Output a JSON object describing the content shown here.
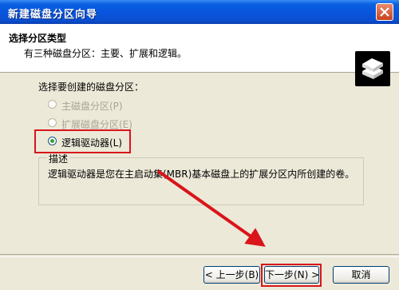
{
  "window": {
    "title": "新建磁盘分区向导"
  },
  "header": {
    "title": "选择分区类型",
    "subtitle": "有三种磁盘分区：主要、扩展和逻辑。",
    "icon": "disk-stack-icon"
  },
  "partition": {
    "section_label": "选择要创建的磁盘分区：",
    "options": [
      {
        "label": "主磁盘分区(P)",
        "enabled": false,
        "selected": false
      },
      {
        "label": "扩展磁盘分区(E)",
        "enabled": false,
        "selected": false
      },
      {
        "label": "逻辑驱动器(L)",
        "enabled": true,
        "selected": true
      }
    ]
  },
  "description": {
    "legend": "描述",
    "text": "逻辑驱动器是您在主启动集(MBR)基本磁盘上的扩展分区内所创建的卷。"
  },
  "buttons": {
    "back": "< 上一步(B)",
    "next": "下一步(N) >",
    "cancel": "取消"
  },
  "colors": {
    "annotation": "#d9141b",
    "titlebar": "#0855dd"
  }
}
